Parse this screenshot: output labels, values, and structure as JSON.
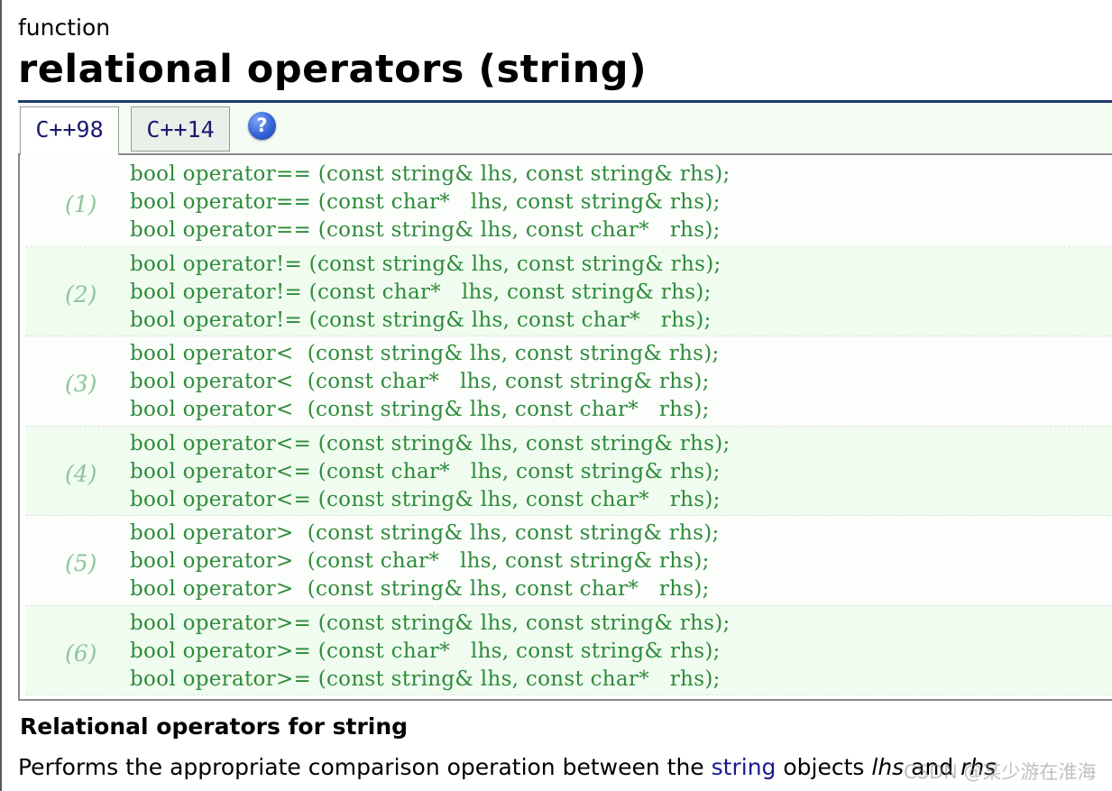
{
  "header": {
    "kind": "function",
    "title": "relational operators (string)"
  },
  "tabs": [
    {
      "label": "C++98",
      "active": true
    },
    {
      "label": "C++14",
      "active": false
    }
  ],
  "help_icon": {
    "glyph": "?",
    "icon": "help-icon"
  },
  "declarations": [
    {
      "num": "(1)",
      "lines": [
        "bool operator== (const string& lhs, const string& rhs);",
        "bool operator== (const char*   lhs, const string& rhs);",
        "bool operator== (const string& lhs, const char*   rhs);"
      ]
    },
    {
      "num": "(2)",
      "lines": [
        "bool operator!= (const string& lhs, const string& rhs);",
        "bool operator!= (const char*   lhs, const string& rhs);",
        "bool operator!= (const string& lhs, const char*   rhs);"
      ]
    },
    {
      "num": "(3)",
      "lines": [
        "bool operator<  (const string& lhs, const string& rhs);",
        "bool operator<  (const char*   lhs, const string& rhs);",
        "bool operator<  (const string& lhs, const char*   rhs);"
      ]
    },
    {
      "num": "(4)",
      "lines": [
        "bool operator<= (const string& lhs, const string& rhs);",
        "bool operator<= (const char*   lhs, const string& rhs);",
        "bool operator<= (const string& lhs, const char*   rhs);"
      ]
    },
    {
      "num": "(5)",
      "lines": [
        "bool operator>  (const string& lhs, const string& rhs);",
        "bool operator>  (const char*   lhs, const string& rhs);",
        "bool operator>  (const string& lhs, const char*   rhs);"
      ]
    },
    {
      "num": "(6)",
      "lines": [
        "bool operator>= (const string& lhs, const string& rhs);",
        "bool operator>= (const char*   lhs, const string& rhs);",
        "bool operator>= (const string& lhs, const char*   rhs);"
      ]
    }
  ],
  "section": {
    "heading": "Relational operators for string",
    "desc_prefix": "Performs the appropriate comparison operation between the ",
    "desc_link": "string",
    "desc_mid": " objects ",
    "desc_lhs": "lhs",
    "desc_and": " and ",
    "desc_rhs": "rhs"
  },
  "watermark": "CSDN @某少游在淮海",
  "colors": {
    "title_rule": "#1e3c6e",
    "code_text": "#2e8b3a",
    "group_number": "#8fc49a",
    "link": "#1a1a8c",
    "tab_text": "#1a1a6e"
  }
}
